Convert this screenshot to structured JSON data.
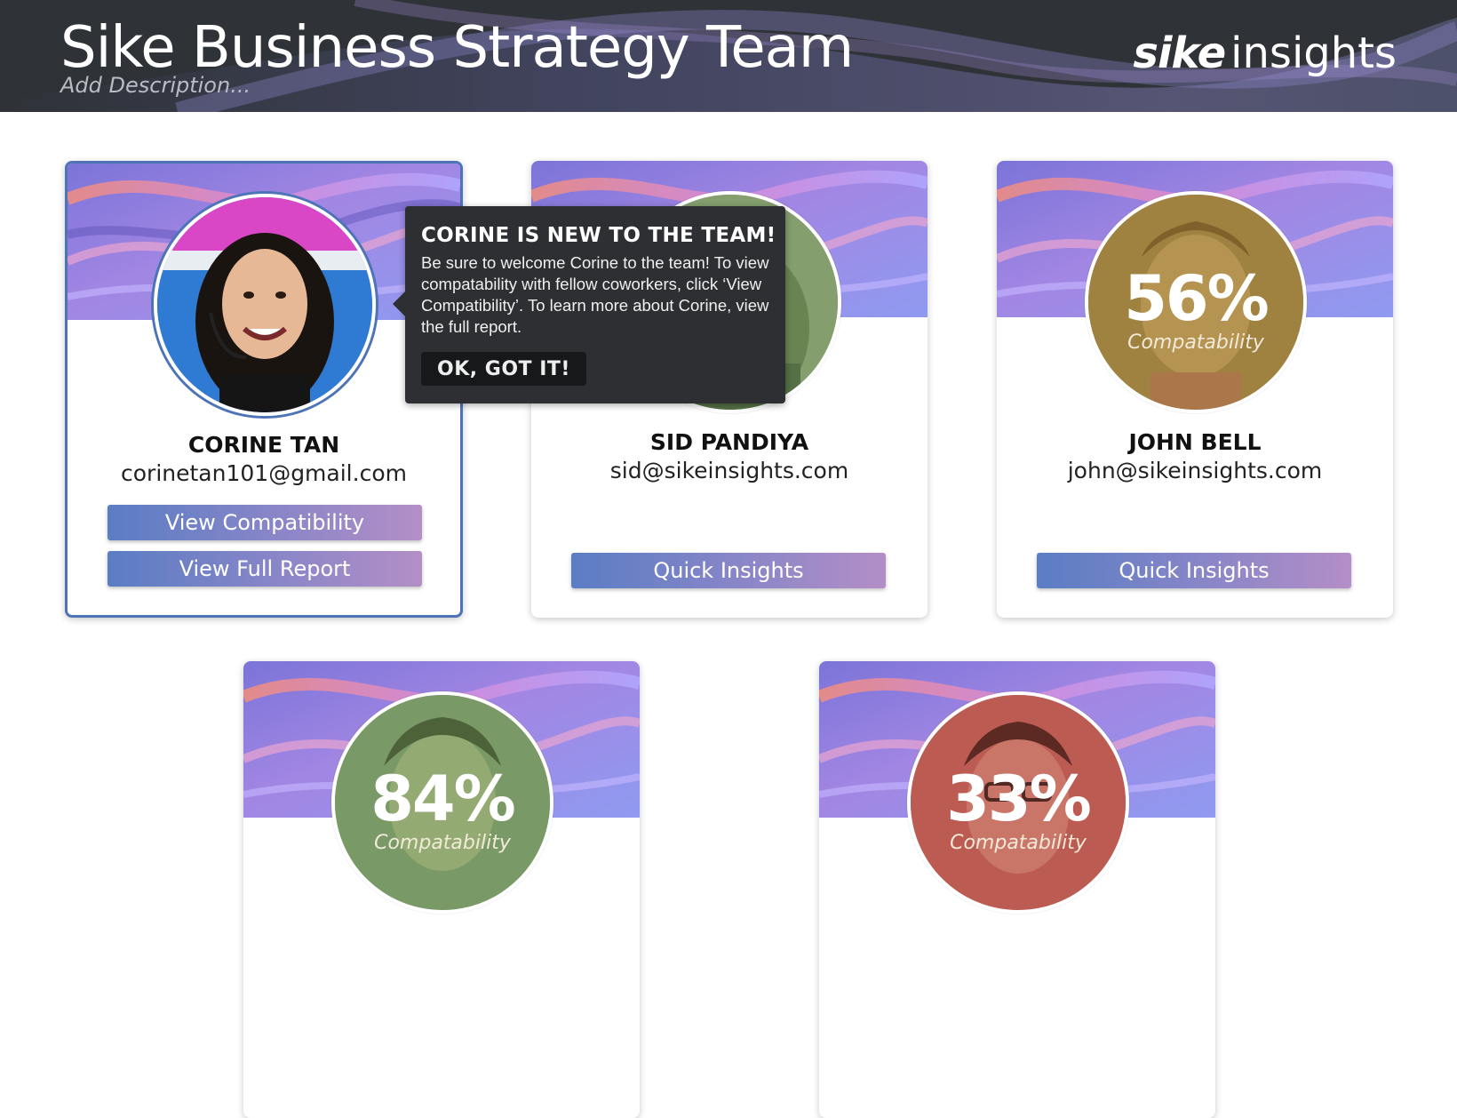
{
  "header": {
    "title": "Sike Business Strategy Team",
    "description_placeholder": "Add Description...",
    "logo_bold": "sike",
    "logo_light": "insights"
  },
  "tooltip": {
    "title": "CORINE IS NEW TO THE TEAM!",
    "body": "Be sure to welcome Corine to the team! To view compatability with fellow coworkers, click ‘View Compatibility’. To learn more about Corine, view the full report.",
    "button": "OK, GOT IT!"
  },
  "members": [
    {
      "name": "CORINE TAN",
      "email": "corinetan101@gmail.com",
      "compat_label": "",
      "compat_pct": "",
      "buttons": [
        "View Compatibility",
        "View Full Report"
      ]
    },
    {
      "name": "SID PANDIYA",
      "email": "sid@sikeinsights.com",
      "compat_pct": "",
      "compat_label": "",
      "buttons": [
        "Quick Insights"
      ]
    },
    {
      "name": "JOHN BELL",
      "email": "john@sikeinsights.com",
      "compat_pct": "56%",
      "compat_label": "Compatability",
      "buttons": [
        "Quick Insights"
      ]
    },
    {
      "name": "",
      "email": "",
      "compat_pct": "84%",
      "compat_label": "Compatability",
      "buttons": []
    },
    {
      "name": "",
      "email": "",
      "compat_pct": "33%",
      "compat_label": "Compatability",
      "buttons": []
    }
  ],
  "colors": {
    "header_bg": "#2f3237",
    "button_start": "#5a7dc4",
    "button_end": "#b48ec6",
    "selected_border": "#4e74b8",
    "tooltip_bg": "#2d2f33"
  }
}
